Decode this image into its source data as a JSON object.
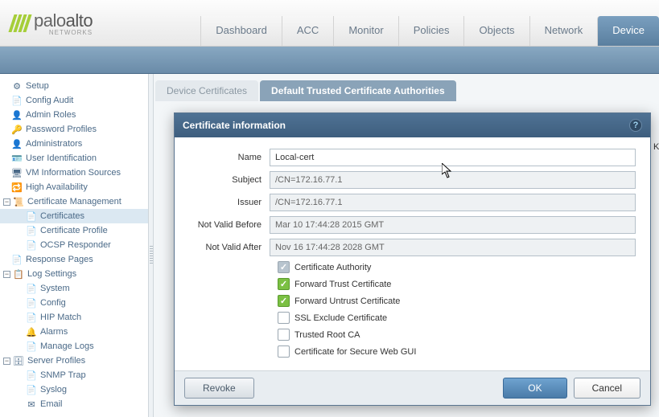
{
  "brand": {
    "name1": "palo",
    "name2": "alto",
    "sub": "NETWORKS"
  },
  "topnav": {
    "items": [
      {
        "label": "Dashboard"
      },
      {
        "label": "ACC"
      },
      {
        "label": "Monitor"
      },
      {
        "label": "Policies"
      },
      {
        "label": "Objects"
      },
      {
        "label": "Network"
      },
      {
        "label": "Device",
        "active": true
      }
    ]
  },
  "sidebar": {
    "setup": "Setup",
    "config_audit": "Config Audit",
    "admin_roles": "Admin Roles",
    "password_profiles": "Password Profiles",
    "administrators": "Administrators",
    "user_id": "User Identification",
    "vm_info": "VM Information Sources",
    "ha": "High Availability",
    "cert_mgmt": "Certificate Management",
    "certificates": "Certificates",
    "cert_profile": "Certificate Profile",
    "ocsp": "OCSP Responder",
    "response_pages": "Response Pages",
    "log_settings": "Log Settings",
    "system": "System",
    "config": "Config",
    "hip_match": "HIP Match",
    "alarms": "Alarms",
    "manage_logs": "Manage Logs",
    "server_profiles": "Server Profiles",
    "snmp": "SNMP Trap",
    "syslog": "Syslog",
    "email": "Email"
  },
  "tabs": {
    "device_certs": "Device Certificates",
    "trusted_ca": "Default Trusted Certificate Authorities"
  },
  "modal": {
    "title": "Certificate information",
    "labels": {
      "name": "Name",
      "subject": "Subject",
      "issuer": "Issuer",
      "nvb": "Not Valid Before",
      "nva": "Not Valid After"
    },
    "values": {
      "name": "Local-cert",
      "subject": "/CN=172.16.77.1",
      "issuer": "/CN=172.16.77.1",
      "nvb": "Mar 10 17:44:28 2015 GMT",
      "nva": "Nov 16 17:44:28 2028 GMT"
    },
    "checks": {
      "ca": "Certificate Authority",
      "fwd_trust": "Forward Trust Certificate",
      "fwd_untrust": "Forward Untrust Certificate",
      "ssl_exclude": "SSL Exclude Certificate",
      "trusted_root": "Trusted Root CA",
      "secure_web": "Certificate for Secure Web GUI"
    },
    "buttons": {
      "revoke": "Revoke",
      "ok": "OK",
      "cancel": "Cancel"
    }
  },
  "fragment": "Ke"
}
